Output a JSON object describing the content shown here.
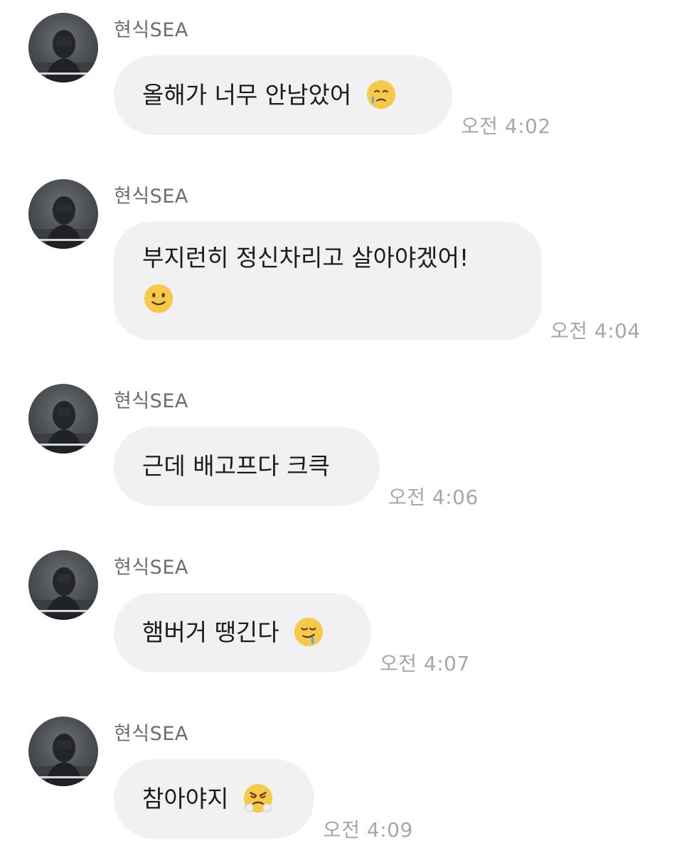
{
  "messages": [
    {
      "sender": "현식SEA",
      "text_lines": [
        "올해가 너무 안남았어"
      ],
      "emoji": "face-holding-back-tears-icon",
      "time": "오전 4:02"
    },
    {
      "sender": "현식SEA",
      "text_lines": [
        "부지런히 정신차리고 살아야겠어!",
        ""
      ],
      "emoji": "slightly-smiling-face-icon",
      "time": "오전 4:04"
    },
    {
      "sender": "현식SEA",
      "text_lines": [
        "근데 배고프다 크큭"
      ],
      "emoji": "",
      "time": "오전 4:06"
    },
    {
      "sender": "현식SEA",
      "text_lines": [
        "햄버거 땡긴다"
      ],
      "emoji": "drooling-face-icon",
      "time": "오전 4:07"
    },
    {
      "sender": "현식SEA",
      "text_lines": [
        "참아야지"
      ],
      "emoji": "face-with-steam-from-nose-icon",
      "time": "오전 4:09"
    }
  ],
  "colors": {
    "bubble": "#f1f1f3",
    "sender": "#6b6d72",
    "time": "#a6a7ab",
    "text": "#1b1b1d",
    "emoji_yellow": "#f7c948"
  }
}
